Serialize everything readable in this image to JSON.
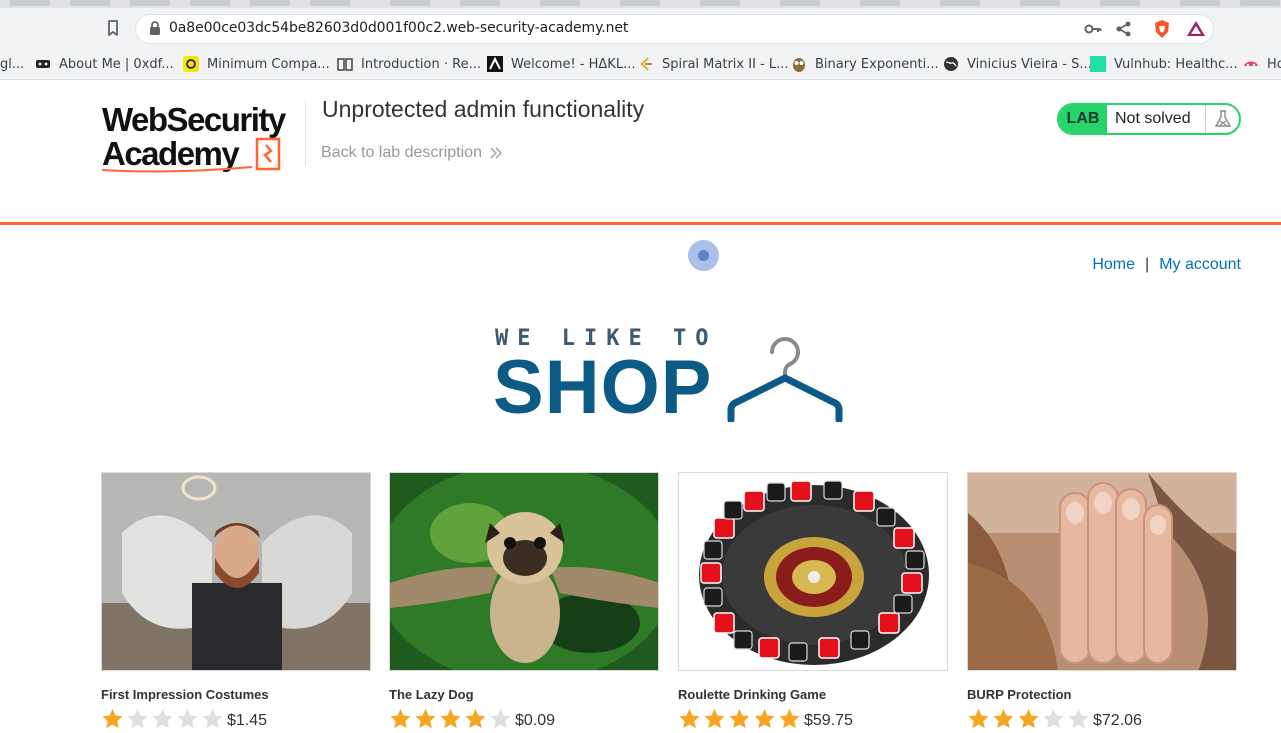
{
  "browser": {
    "url": "0a8e00ce03dc54be82603d0d001f00c2.web-security-academy.net",
    "bookmarks": [
      {
        "label": "gl...",
        "icon": "google-icon"
      },
      {
        "label": "About Me | 0xdf...",
        "icon": "0xdf-icon"
      },
      {
        "label": "Minimum Compa...",
        "icon": "minimum-icon"
      },
      {
        "label": "Introduction · Re...",
        "icon": "book-icon"
      },
      {
        "label": "Welcome! - HΔKL...",
        "icon": "hakl-icon"
      },
      {
        "label": "Spiral Matrix II - L...",
        "icon": "leetcode-icon"
      },
      {
        "label": "Binary Exponenti...",
        "icon": "owl-icon"
      },
      {
        "label": "Vinicius Vieira - S...",
        "icon": "globe-icon"
      },
      {
        "label": "Vulnhub: Healthc...",
        "icon": "vulnhub-icon"
      },
      {
        "label": "Ho",
        "icon": "ho-icon"
      }
    ]
  },
  "lab": {
    "logo_line1": "WebSecurity",
    "logo_line2": "Academy",
    "title": "Unprotected admin functionality",
    "back_link": "Back to lab description",
    "badge": "LAB",
    "status": "Not solved"
  },
  "nav": {
    "home": "Home",
    "separator": "|",
    "account": "My account"
  },
  "hero": {
    "tagline": "WE LIKE TO",
    "headline": "SHOP"
  },
  "products": [
    {
      "name": "First Impression Costumes",
      "rating": 1,
      "price": "$1.45"
    },
    {
      "name": "The Lazy Dog",
      "rating": 4,
      "price": "$0.09"
    },
    {
      "name": "Roulette Drinking Game",
      "rating": 5,
      "price": "$59.75"
    },
    {
      "name": "BURP Protection",
      "rating": 3,
      "price": "$72.06"
    }
  ],
  "colors": {
    "accent_orange": "#ff6633",
    "lab_green": "#26d46a",
    "link_blue": "#0071bc",
    "shop_blue": "#0c5a86",
    "star_gold": "#f5a623",
    "star_empty": "#e0e0e0"
  }
}
